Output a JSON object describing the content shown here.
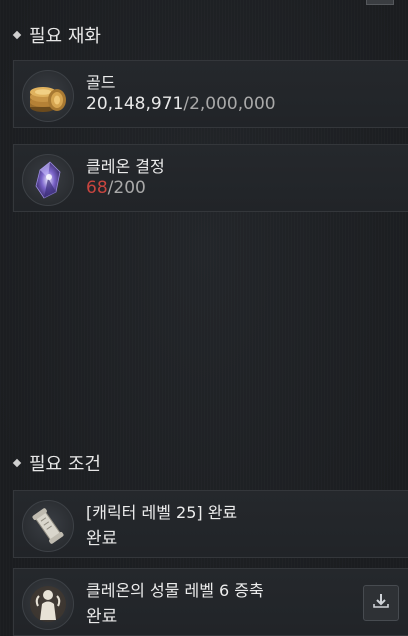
{
  "materials_section": {
    "title": "필요 재화",
    "items": [
      {
        "name": "골드",
        "owned": "20,148,971",
        "separator": "/",
        "required": "2,000,000",
        "icon": "gold-coins-icon"
      },
      {
        "name": "클레온 결정",
        "owned": "68",
        "separator": "/",
        "required": "200",
        "icon": "crystal-icon"
      }
    ]
  },
  "conditions_section": {
    "title": "필요 조건",
    "items": [
      {
        "name": "[캐릭터 레벨 25] 완료",
        "status": "완료",
        "icon": "scroll-icon"
      },
      {
        "name": "클레온의 성물 레벨 6 증축",
        "status": "완료",
        "icon": "statue-icon",
        "action_icon": "download-icon"
      }
    ]
  },
  "colors": {
    "shortfall": "#c8453f",
    "background": "#1d1f22"
  }
}
